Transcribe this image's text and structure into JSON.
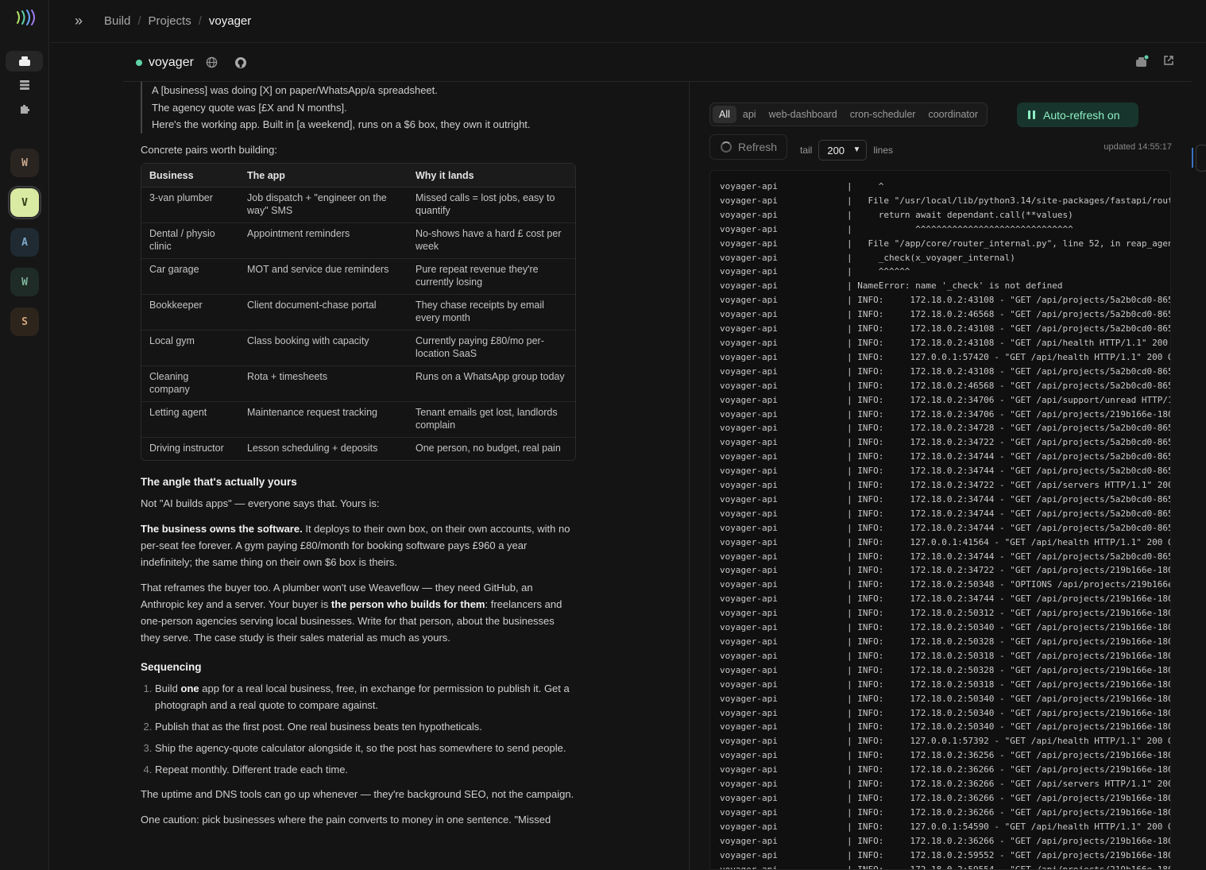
{
  "breadcrumb": [
    "Build",
    "Projects",
    "voyager"
  ],
  "rail": {
    "projects": [
      {
        "letter": "W",
        "bg": "#2a2420",
        "fg": "#c9a98f"
      },
      {
        "letter": "V",
        "bg": "#d9eaa3",
        "fg": "#2a3a10",
        "active": true
      },
      {
        "letter": "A",
        "bg": "#1f2a33",
        "fg": "#7fa7c6"
      },
      {
        "letter": "W",
        "bg": "#1f2b26",
        "fg": "#7fb59d"
      },
      {
        "letter": "S",
        "bg": "#2d241c",
        "fg": "#d1a47a"
      }
    ]
  },
  "project": {
    "name": "voyager",
    "status_color": "#5fd3a8"
  },
  "doc": {
    "quote": [
      "A [business] was doing [X] on paper/WhatsApp/a spreadsheet.",
      "The agency quote was [£X and N months].",
      "Here's the working app. Built in [a weekend], runs on a $6 box, they own it outright."
    ],
    "pairs_intro": "Concrete pairs worth building:",
    "table": {
      "headers": [
        "Business",
        "The app",
        "Why it lands"
      ],
      "rows": [
        [
          "3-van plumber",
          "Job dispatch + \"engineer on the way\" SMS",
          "Missed calls = lost jobs, easy to quantify"
        ],
        [
          "Dental / physio clinic",
          "Appointment reminders",
          "No-shows have a hard £ cost per week"
        ],
        [
          "Car garage",
          "MOT and service due reminders",
          "Pure repeat revenue they're currently losing"
        ],
        [
          "Bookkeeper",
          "Client document-chase portal",
          "They chase receipts by email every month"
        ],
        [
          "Local gym",
          "Class booking with capacity",
          "Currently paying £80/mo per-location SaaS"
        ],
        [
          "Cleaning company",
          "Rota + timesheets",
          "Runs on a WhatsApp group today"
        ],
        [
          "Letting agent",
          "Maintenance request tracking",
          "Tenant emails get lost, landlords complain"
        ],
        [
          "Driving instructor",
          "Lesson scheduling + deposits",
          "One person, no budget, real pain"
        ]
      ]
    },
    "angle_heading": "The angle that's actually yours",
    "angle_intro": "Not \"AI builds apps\" — everyone says that. Yours is:",
    "owns_bold": "The business owns the software.",
    "owns_rest": " It deploys to their own box, on their own accounts, with no per-seat fee forever. A gym paying £80/month for booking software pays £960 a year indefinitely; the same thing on their own $6 box is theirs.",
    "reframe_a": "That reframes the buyer too. A plumber won't use Weaveflow — they need GitHub, an Anthropic key and a server. Your buyer is ",
    "reframe_bold": "the person who builds for them",
    "reframe_b": ": freelancers and one-person agencies serving local businesses. Write for that person, about the businesses they serve. The case study is their sales material as much as yours.",
    "seq_heading": "Sequencing",
    "seq1_a": "Build ",
    "seq1_bold": "one",
    "seq1_b": " app for a real local business, free, in exchange for permission to publish it. Get a photograph and a real quote to compare against.",
    "seq2": "Publish that as the first post. One real business beats ten hypotheticals.",
    "seq3": "Ship the agency-quote calculator alongside it, so the post has somewhere to send people.",
    "seq4": "Repeat monthly. Different trade each time.",
    "uptime": "The uptime and DNS tools can go up whenever — they're background SEO, not the campaign.",
    "caution": "One caution: pick businesses where the pain converts to money in one sentence. \"Missed"
  },
  "logs": {
    "filters": [
      "All",
      "api",
      "web-dashboard",
      "cron-scheduler",
      "coordinator"
    ],
    "active_filter": "All",
    "autorefresh_label": "Auto-refresh on",
    "refresh_label": "Refresh",
    "tail_label": "tail",
    "tail_value": "200",
    "lines_label": "lines",
    "updated": "updated 14:55:17",
    "lines": [
      [
        "voyager-api",
        "|     ^"
      ],
      [
        "voyager-api",
        "|   File \"/usr/local/lib/python3.14/site-packages/fastapi/rout"
      ],
      [
        "voyager-api",
        "|     return await dependant.call(**values)"
      ],
      [
        "voyager-api",
        "|            ^^^^^^^^^^^^^^^^^^^^^^^^^^^^^^"
      ],
      [
        "voyager-api",
        "|   File \"/app/core/router_internal.py\", line 52, in reap_agen"
      ],
      [
        "voyager-api",
        "|     _check(x_voyager_internal)"
      ],
      [
        "voyager-api",
        "|     ^^^^^^"
      ],
      [
        "voyager-api",
        "| NameError: name '_check' is not defined"
      ],
      [
        "voyager-api",
        "| INFO:     172.18.0.2:43108 - \"GET /api/projects/5a2b0cd0-865"
      ],
      [
        "voyager-api",
        "| INFO:     172.18.0.2:46568 - \"GET /api/projects/5a2b0cd0-865"
      ],
      [
        "voyager-api",
        "| INFO:     172.18.0.2:43108 - \"GET /api/projects/5a2b0cd0-865"
      ],
      [
        "voyager-api",
        "| INFO:     172.18.0.2:43108 - \"GET /api/health HTTP/1.1\" 200"
      ],
      [
        "voyager-api",
        "| INFO:     127.0.0.1:57420 - \"GET /api/health HTTP/1.1\" 200 O"
      ],
      [
        "voyager-api",
        "| INFO:     172.18.0.2:43108 - \"GET /api/projects/5a2b0cd0-865"
      ],
      [
        "voyager-api",
        "| INFO:     172.18.0.2:46568 - \"GET /api/projects/5a2b0cd0-865"
      ],
      [
        "voyager-api",
        "| INFO:     172.18.0.2:34706 - \"GET /api/support/unread HTTP/1"
      ],
      [
        "voyager-api",
        "| INFO:     172.18.0.2:34706 - \"GET /api/projects/219b166e-180"
      ],
      [
        "voyager-api",
        "| INFO:     172.18.0.2:34728 - \"GET /api/projects/5a2b0cd0-865"
      ],
      [
        "voyager-api",
        "| INFO:     172.18.0.2:34722 - \"GET /api/projects/5a2b0cd0-865"
      ],
      [
        "voyager-api",
        "| INFO:     172.18.0.2:34744 - \"GET /api/projects/5a2b0cd0-865"
      ],
      [
        "voyager-api",
        "| INFO:     172.18.0.2:34744 - \"GET /api/projects/5a2b0cd0-865"
      ],
      [
        "voyager-api",
        "| INFO:     172.18.0.2:34722 - \"GET /api/servers HTTP/1.1\" 200"
      ],
      [
        "voyager-api",
        "| INFO:     172.18.0.2:34744 - \"GET /api/projects/5a2b0cd0-865"
      ],
      [
        "voyager-api",
        "| INFO:     172.18.0.2:34744 - \"GET /api/projects/5a2b0cd0-865"
      ],
      [
        "voyager-api",
        "| INFO:     172.18.0.2:34744 - \"GET /api/projects/5a2b0cd0-865"
      ],
      [
        "voyager-api",
        "| INFO:     127.0.0.1:41564 - \"GET /api/health HTTP/1.1\" 200 O"
      ],
      [
        "voyager-api",
        "| INFO:     172.18.0.2:34744 - \"GET /api/projects/5a2b0cd0-865"
      ],
      [
        "voyager-api",
        "| INFO:     172.18.0.2:34722 - \"GET /api/projects/219b166e-180"
      ],
      [
        "voyager-api",
        "| INFO:     172.18.0.2:50348 - \"OPTIONS /api/projects/219b166e"
      ],
      [
        "voyager-api",
        "| INFO:     172.18.0.2:34744 - \"GET /api/projects/219b166e-180"
      ],
      [
        "voyager-api",
        "| INFO:     172.18.0.2:50312 - \"GET /api/projects/219b166e-180"
      ],
      [
        "voyager-api",
        "| INFO:     172.18.0.2:50340 - \"GET /api/projects/219b166e-180"
      ],
      [
        "voyager-api",
        "| INFO:     172.18.0.2:50328 - \"GET /api/projects/219b166e-180"
      ],
      [
        "voyager-api",
        "| INFO:     172.18.0.2:50318 - \"GET /api/projects/219b166e-180"
      ],
      [
        "voyager-api",
        "| INFO:     172.18.0.2:50328 - \"GET /api/projects/219b166e-180"
      ],
      [
        "voyager-api",
        "| INFO:     172.18.0.2:50318 - \"GET /api/projects/219b166e-180"
      ],
      [
        "voyager-api",
        "| INFO:     172.18.0.2:50340 - \"GET /api/projects/219b166e-180"
      ],
      [
        "voyager-api",
        "| INFO:     172.18.0.2:50340 - \"GET /api/projects/219b166e-180"
      ],
      [
        "voyager-api",
        "| INFO:     172.18.0.2:50340 - \"GET /api/projects/219b166e-180"
      ],
      [
        "voyager-api",
        "| INFO:     127.0.0.1:57392 - \"GET /api/health HTTP/1.1\" 200 O"
      ],
      [
        "voyager-api",
        "| INFO:     172.18.0.2:36256 - \"GET /api/projects/219b166e-180"
      ],
      [
        "voyager-api",
        "| INFO:     172.18.0.2:36266 - \"GET /api/projects/219b166e-180"
      ],
      [
        "voyager-api",
        "| INFO:     172.18.0.2:36266 - \"GET /api/servers HTTP/1.1\" 200"
      ],
      [
        "voyager-api",
        "| INFO:     172.18.0.2:36266 - \"GET /api/projects/219b166e-180"
      ],
      [
        "voyager-api",
        "| INFO:     172.18.0.2:36266 - \"GET /api/projects/219b166e-180"
      ],
      [
        "voyager-api",
        "| INFO:     127.0.0.1:54590 - \"GET /api/health HTTP/1.1\" 200 O"
      ],
      [
        "voyager-api",
        "| INFO:     172.18.0.2:36266 - \"GET /api/projects/219b166e-180"
      ],
      [
        "voyager-api",
        "| INFO:     172.18.0.2:59552 - \"GET /api/projects/219b166e-180"
      ],
      [
        "voyager-api",
        "| INFO:     172.18.0.2:59554 - \"GET /api/projects/219b166e-180"
      ]
    ]
  }
}
